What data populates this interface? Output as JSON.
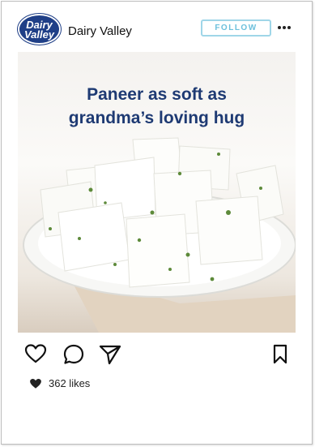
{
  "post": {
    "account_name": "Dairy Valley",
    "logo_line1": "Dairy",
    "logo_line2": "Valley",
    "follow_label": "FOLLOW",
    "more_icon": "more-dots-icon",
    "caption_line1": "Paneer as soft as",
    "caption_line2": "grandma’s loving hug",
    "likes_text": "362 likes"
  },
  "actions": {
    "like_icon": "heart-outline-icon",
    "comment_icon": "comment-bubble-icon",
    "share_icon": "send-icon",
    "save_icon": "bookmark-icon"
  },
  "colors": {
    "brand_blue": "#1f3f87",
    "caption_blue": "#1e3a73",
    "follow_border": "#9fd6e8"
  }
}
